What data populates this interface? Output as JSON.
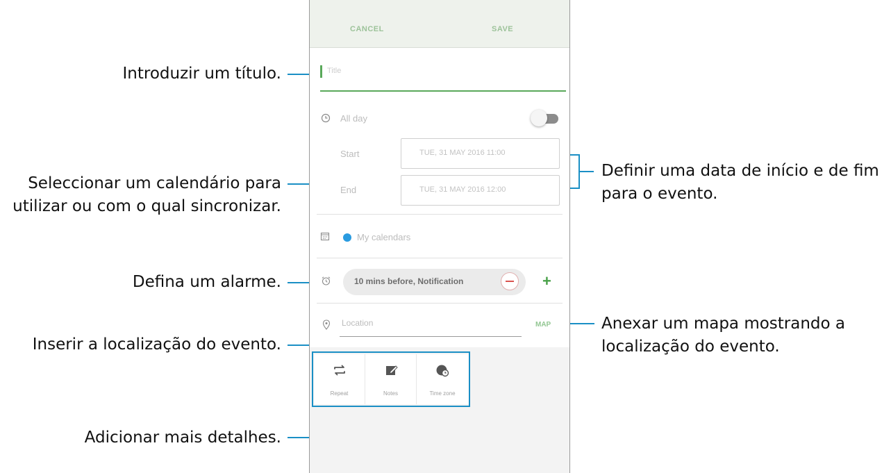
{
  "screen": {
    "cancel_label": "CANCEL",
    "save_label": "SAVE",
    "title_placeholder": "Title",
    "all_day_label": "All day",
    "start_label": "Start",
    "end_label": "End",
    "start_value": "TUE, 31 MAY 2016   11:00",
    "end_value": "TUE, 31 MAY 2016   12:00",
    "calendar_label": "My calendars",
    "calendar_color": "#2a9be0",
    "alarm_value": "10 mins before, Notification",
    "location_placeholder": "Location",
    "map_label": "MAP",
    "accent_color": "#59a85a",
    "extras": [
      {
        "label": "Repeat",
        "icon": "repeat-icon"
      },
      {
        "label": "Notes",
        "icon": "notes-icon"
      },
      {
        "label": "Time zone",
        "icon": "time-zone-icon"
      }
    ]
  },
  "annotations": {
    "title": "Introduzir um título.",
    "calendar_line1": "Seleccionar um calendário para",
    "calendar_line2": "utilizar ou com o qual sincronizar.",
    "alarm": "Defina um alarme.",
    "location": "Inserir a localização do evento.",
    "details": "Adicionar mais detalhes.",
    "dates_line1": "Definir uma data de início e de fim",
    "dates_line2": "para o evento.",
    "map_line1": "Anexar um mapa mostrando a",
    "map_line2": "localização do evento."
  },
  "colors": {
    "callout_line": "#1a8fc5",
    "alarm_remove": "#d9534f",
    "add_green": "#4aa14a"
  }
}
